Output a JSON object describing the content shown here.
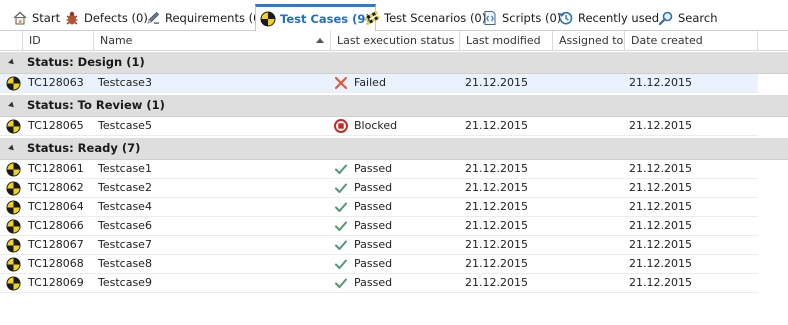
{
  "tabs": [
    {
      "label": "Start",
      "icon": "home-icon"
    },
    {
      "label": "Defects (0)",
      "icon": "bug-icon"
    },
    {
      "label": "Requirements (0)",
      "icon": "pencil-icon"
    },
    {
      "label": "Test Cases (9)",
      "icon": "testcase-icon"
    },
    {
      "label": "Test Scenarios (0)",
      "icon": "scenario-icon"
    },
    {
      "label": "Scripts (0)",
      "icon": "script-icon"
    },
    {
      "label": "Recently used",
      "icon": "history-icon"
    },
    {
      "label": "Search",
      "icon": "search-icon"
    }
  ],
  "active_tab": "Test Cases (9)",
  "columns": [
    "ID",
    "Name",
    "Last execution status",
    "Last modified",
    "Assigned to",
    "Date created"
  ],
  "sorted_column": "Name",
  "groups": [
    {
      "label": "Status: Design (1)",
      "rows": [
        {
          "id": "TC128063",
          "name": "Testcase3",
          "status": "Failed",
          "status_icon": "failed-icon",
          "last_modified": "21.12.2015",
          "assigned_to": "",
          "date_created": "21.12.2015"
        }
      ]
    },
    {
      "label": "Status: To Review (1)",
      "rows": [
        {
          "id": "TC128065",
          "name": "Testcase5",
          "status": "Blocked",
          "status_icon": "blocked-icon",
          "last_modified": "21.12.2015",
          "assigned_to": "",
          "date_created": "21.12.2015"
        }
      ]
    },
    {
      "label": "Status: Ready (7)",
      "rows": [
        {
          "id": "TC128061",
          "name": "Testcase1",
          "status": "Passed",
          "status_icon": "passed-icon",
          "last_modified": "21.12.2015",
          "assigned_to": "",
          "date_created": "21.12.2015"
        },
        {
          "id": "TC128062",
          "name": "Testcase2",
          "status": "Passed",
          "status_icon": "passed-icon",
          "last_modified": "21.12.2015",
          "assigned_to": "",
          "date_created": "21.12.2015"
        },
        {
          "id": "TC128064",
          "name": "Testcase4",
          "status": "Passed",
          "status_icon": "passed-icon",
          "last_modified": "21.12.2015",
          "assigned_to": "",
          "date_created": "21.12.2015"
        },
        {
          "id": "TC128066",
          "name": "Testcase6",
          "status": "Passed",
          "status_icon": "passed-icon",
          "last_modified": "21.12.2015",
          "assigned_to": "",
          "date_created": "21.12.2015"
        },
        {
          "id": "TC128067",
          "name": "Testcase7",
          "status": "Passed",
          "status_icon": "passed-icon",
          "last_modified": "21.12.2015",
          "assigned_to": "",
          "date_created": "21.12.2015"
        },
        {
          "id": "TC128068",
          "name": "Testcase8",
          "status": "Passed",
          "status_icon": "passed-icon",
          "last_modified": "21.12.2015",
          "assigned_to": "",
          "date_created": "21.12.2015"
        },
        {
          "id": "TC128069",
          "name": "Testcase9",
          "status": "Passed",
          "status_icon": "passed-icon",
          "last_modified": "21.12.2015",
          "assigned_to": "",
          "date_created": "21.12.2015"
        }
      ]
    }
  ],
  "colors": {
    "accent": "#2a7ad9",
    "failed": "#e05a3a",
    "blocked": "#c62828",
    "passed": "#4f9a72",
    "group_bg": "#dedede",
    "selected_row_bg": "#eaf3fd"
  }
}
